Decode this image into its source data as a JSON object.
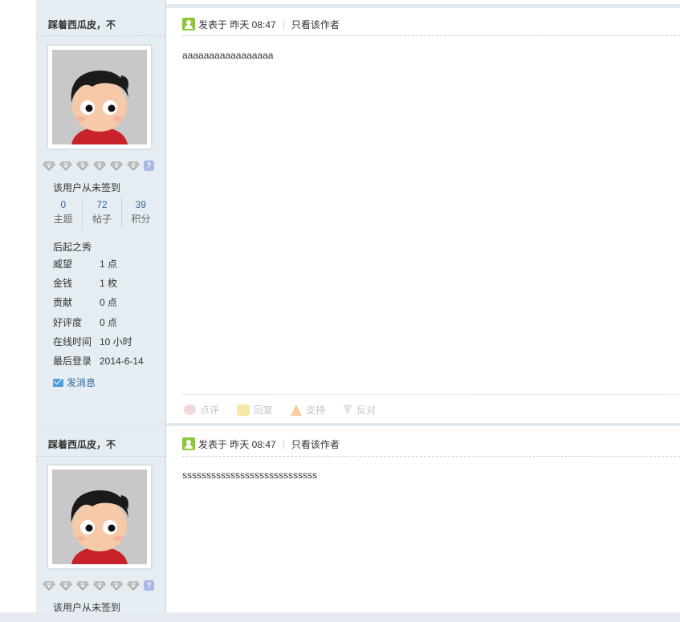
{
  "posts": [
    {
      "author": "踩着西瓜皮，不",
      "signin_status": "该用户从未签到",
      "stats": [
        {
          "value": "0",
          "label": "主题"
        },
        {
          "value": "72",
          "label": "帖子"
        },
        {
          "value": "39",
          "label": "积分"
        }
      ],
      "rank": "后起之秀",
      "profile": [
        {
          "key": "威望",
          "value": "1 点"
        },
        {
          "key": "金钱",
          "value": "1 枚"
        },
        {
          "key": "贡献",
          "value": "0 点"
        },
        {
          "key": "好评度",
          "value": "0 点"
        },
        {
          "key": "在线时间",
          "value": "10 小时"
        },
        {
          "key": "最后登录",
          "value": "2014-6-14"
        }
      ],
      "send_message": "发消息",
      "posted_at": "发表于 昨天 08:47",
      "author_only": "只看该作者",
      "content": "aaaaaaaaaaaaaaaaa",
      "actions": {
        "rate": "点评",
        "reply": "回复",
        "support": "支持",
        "oppose": "反对"
      }
    },
    {
      "author": "踩着西瓜皮，不",
      "signin_status": "该用户从未签到",
      "posted_at": "发表于 昨天 08:47",
      "author_only": "只看该作者",
      "content": "ssssssssssssssssssssssssssss"
    }
  ],
  "separator": "|",
  "badge": "?",
  "colors": {
    "sidebar_bg": "#e5edf2",
    "link": "#336699",
    "user_icon": "#8cc63f"
  }
}
